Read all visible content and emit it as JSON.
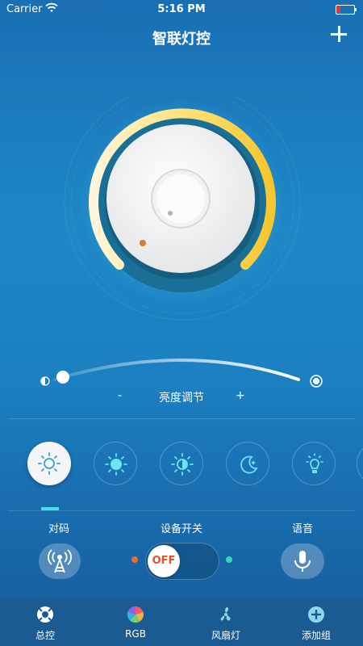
{
  "status_bar": {
    "carrier": "Carrier",
    "time": "5:16 PM"
  },
  "header": {
    "title": "智联灯控",
    "add_icon": "plus-icon"
  },
  "brightness": {
    "label": "亮度调节",
    "minus": "-",
    "plus": "+",
    "level": 0.05
  },
  "modes": [
    {
      "name": "mode-sun-outline",
      "icon": "sun-outline-icon",
      "active": true
    },
    {
      "name": "mode-sun-full",
      "icon": "sun-full-icon",
      "active": false
    },
    {
      "name": "mode-sun-half",
      "icon": "sun-half-icon",
      "active": false
    },
    {
      "name": "mode-night",
      "icon": "moon-star-icon",
      "active": false
    },
    {
      "name": "mode-bulb",
      "icon": "bulb-icon",
      "active": false
    }
  ],
  "controls": {
    "pair_label": "对码",
    "switch_label": "设备开关",
    "voice_label": "语音",
    "toggle_text": "OFF",
    "toggle_on": false
  },
  "tabbar": {
    "items": [
      {
        "label": "总控",
        "icon": "control-icon"
      },
      {
        "label": "RGB",
        "icon": "rgb-wheel-icon"
      },
      {
        "label": "风扇灯",
        "icon": "fan-icon"
      },
      {
        "label": "添加组",
        "icon": "add-group-icon"
      }
    ]
  },
  "colors": {
    "accent": "#f5c842",
    "tab_active": "#ffffff",
    "indicator": "#46e0e8"
  }
}
